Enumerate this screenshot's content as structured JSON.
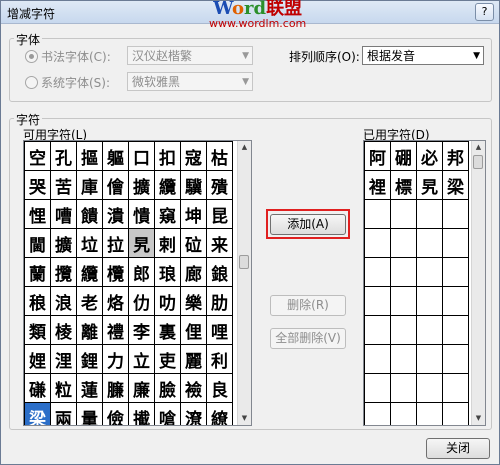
{
  "window": {
    "title": "增减字符",
    "help": "?",
    "close": "✕"
  },
  "watermark": {
    "brand_w": "W",
    "brand_o": "o",
    "brand_rd": "rd",
    "brand_cn": "联盟",
    "url": "www.wordlm.com"
  },
  "font_group": {
    "label": "字体",
    "calligraphy_font": {
      "label": "书法字体(C):",
      "selected": true,
      "value": "汉仪赵楷繁"
    },
    "system_font": {
      "label": "系统字体(S):",
      "selected": false,
      "value": "微软雅黑"
    },
    "sort_order": {
      "label": "排列顺序(O):",
      "value": "根据发音"
    }
  },
  "chars_group": {
    "label": "字符",
    "available_label": "可用字符(L)",
    "used_label": "已用字符(D)",
    "available_rows": [
      [
        "空",
        "孔",
        "摳",
        "軀",
        "口",
        "扣",
        "寇",
        "枯"
      ],
      [
        "哭",
        "苦",
        "庫",
        "儈",
        "擴",
        "纜",
        "驥",
        "殨"
      ],
      [
        "悝",
        "嘈",
        "饋",
        "潰",
        "憒",
        "窺",
        "坤",
        "昆"
      ],
      [
        "閫",
        "擴",
        "垃",
        "拉",
        "旯",
        "剌",
        "砬",
        "来"
      ],
      [
        "蘭",
        "攬",
        "纜",
        "欖",
        "郎",
        "琅",
        "廊",
        "鋃"
      ],
      [
        "稂",
        "浪",
        "老",
        "烙",
        "仂",
        "叻",
        "樂",
        "肋"
      ],
      [
        "類",
        "棱",
        "離",
        "禮",
        "李",
        "裏",
        "俚",
        "哩"
      ],
      [
        "娌",
        "浬",
        "鋰",
        "力",
        "立",
        "吏",
        "麗",
        "利"
      ],
      [
        "磏",
        "粒",
        "蓮",
        "臁",
        "廉",
        "臉",
        "襝",
        "良"
      ],
      [
        "梁",
        "兩",
        "量",
        "儉",
        "擮",
        "嗆",
        "潦",
        "繚"
      ]
    ],
    "used_rows": [
      [
        "阿",
        "硼",
        "必",
        "邦"
      ],
      [
        "裡",
        "標",
        "旯",
        "梁"
      ],
      [
        "",
        "",
        "",
        ""
      ],
      [
        "",
        "",
        "",
        ""
      ],
      [
        "",
        "",
        "",
        ""
      ],
      [
        "",
        "",
        "",
        ""
      ],
      [
        "",
        "",
        "",
        ""
      ],
      [
        "",
        "",
        "",
        ""
      ],
      [
        "",
        "",
        "",
        ""
      ],
      [
        "",
        "",
        "",
        ""
      ]
    ]
  },
  "buttons": {
    "add": "添加(A)",
    "remove": "删除(R)",
    "remove_all": "全部删除(V)",
    "close": "关闭"
  },
  "colors": {
    "selection": "#2b6ec8",
    "highlight_frame": "#e02020"
  }
}
